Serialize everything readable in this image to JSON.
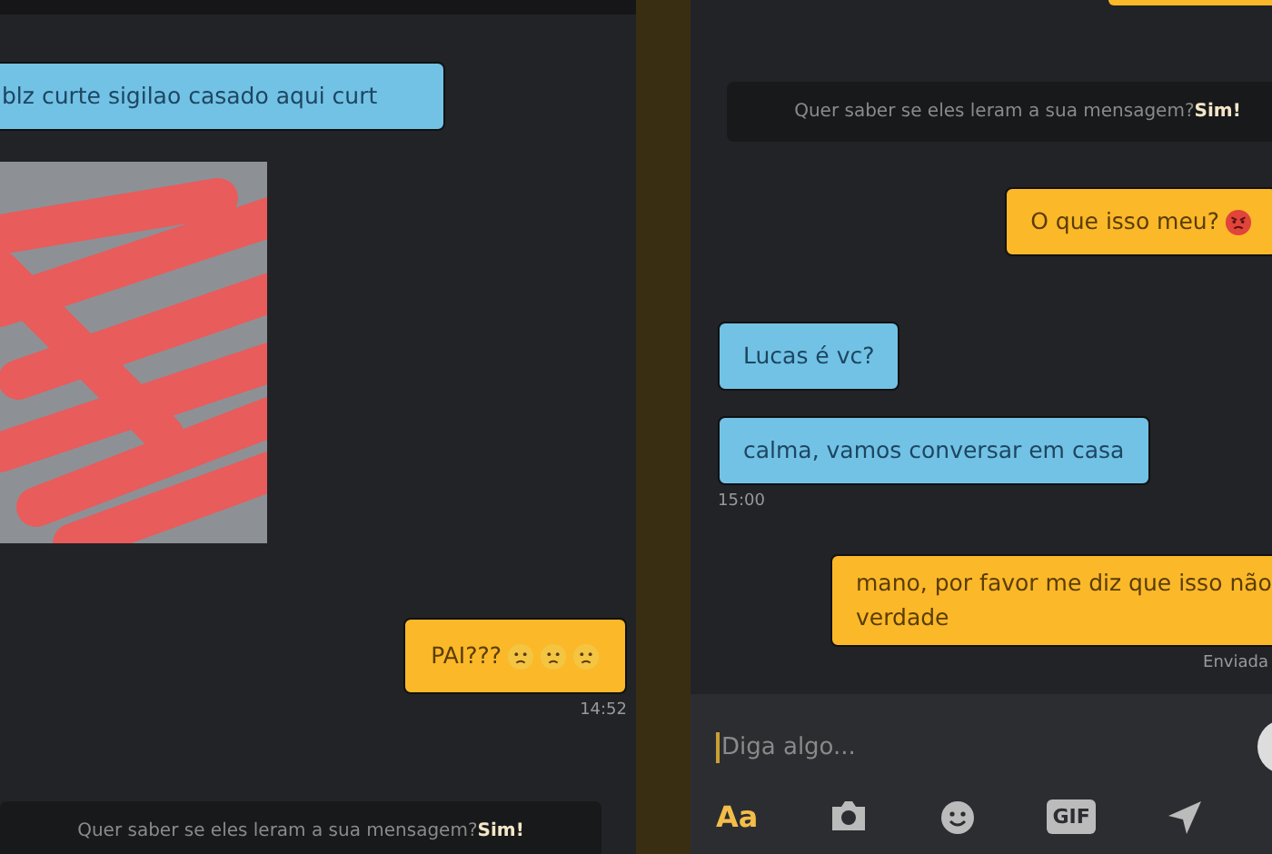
{
  "left_panel": {
    "messages": [
      {
        "kind": "received",
        "text": "blz curte sigilao casado aqui curt"
      },
      {
        "kind": "photo"
      },
      {
        "kind": "sent",
        "text": "PAI???",
        "emojis": [
          {
            "kind": "worried"
          },
          {
            "kind": "worried"
          },
          {
            "kind": "worried"
          }
        ],
        "time": "14:52"
      },
      {
        "kind": "notice",
        "text": "Quer saber se eles leram a sua mensagem?**Sim!**"
      }
    ]
  },
  "right_panel": {
    "messages": [
      {
        "kind": "partial"
      },
      {
        "kind": "notice",
        "text": "Quer saber se eles leram a sua mensagem?**Sim!**"
      },
      {
        "kind": "sent",
        "text": "O que isso meu?",
        "emojis": [
          {
            "kind": "angry"
          }
        ]
      },
      {
        "kind": "received",
        "text": "Lucas é vc?"
      },
      {
        "kind": "received",
        "text": "calma, vamos conversar em casa",
        "time": "15:00"
      },
      {
        "kind": "sent",
        "text": "mano, por favor me diz que isso não\nverdade",
        "status": "Enviada"
      }
    ],
    "composer": {
      "placeholder": "Diga algo...",
      "tools": [
        {
          "kind": "text",
          "label": "Aa"
        },
        {
          "kind": "camera"
        },
        {
          "kind": "emoji"
        },
        {
          "kind": "gif",
          "label": "GIF"
        },
        {
          "kind": "location"
        }
      ]
    }
  }
}
